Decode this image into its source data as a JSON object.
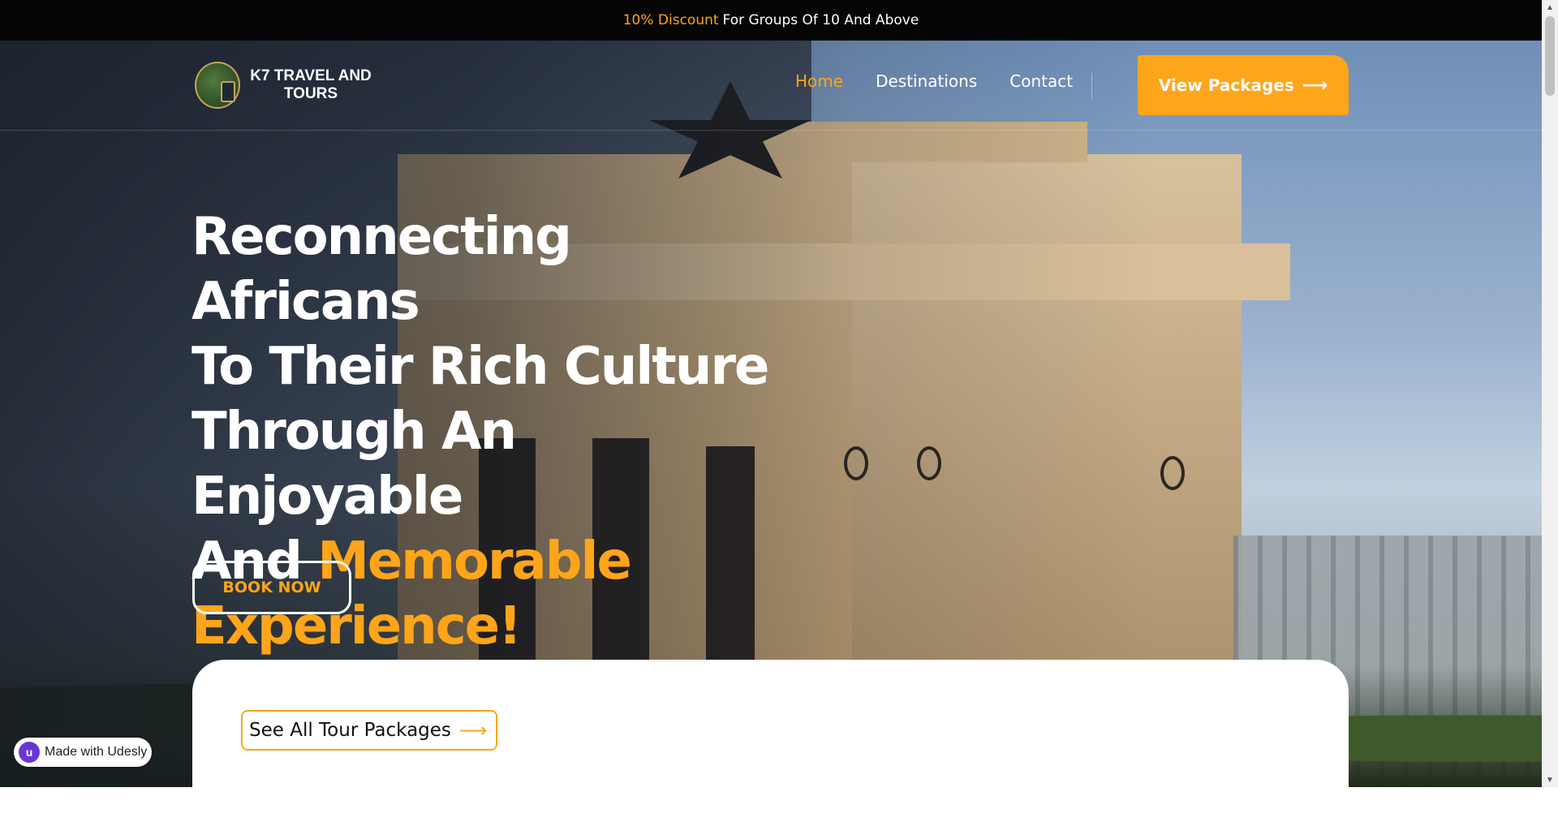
{
  "topbar": {
    "accent": "10% Discount",
    "text": "For Groups Of 10 And Above"
  },
  "logo": {
    "name": "K7 TRAVEL AND TOURS"
  },
  "nav": {
    "items": [
      {
        "label": "Home",
        "active": true
      },
      {
        "label": "Destinations",
        "active": false
      },
      {
        "label": "Contact",
        "active": false
      }
    ],
    "cta_label": "View Packages",
    "cta_icon": "arrow-right-icon"
  },
  "hero": {
    "line1": "Reconnecting Africans",
    "line2": "To Their Rich Culture",
    "line3": "Through An Enjoyable",
    "line4_plain": "And",
    "line4_accent": "Memorable",
    "line5_accent": "Experience!",
    "book_label": "BOOK NOW"
  },
  "packages": {
    "see_all_label": "See All Tour Packages",
    "icon": "arrow-right-icon"
  },
  "badge": {
    "label": "Made with Udesly",
    "logo_letter": "u"
  },
  "colors": {
    "accent": "#ffa51a",
    "topbar_bg": "#050505",
    "badge_logo": "#6a35d6"
  }
}
